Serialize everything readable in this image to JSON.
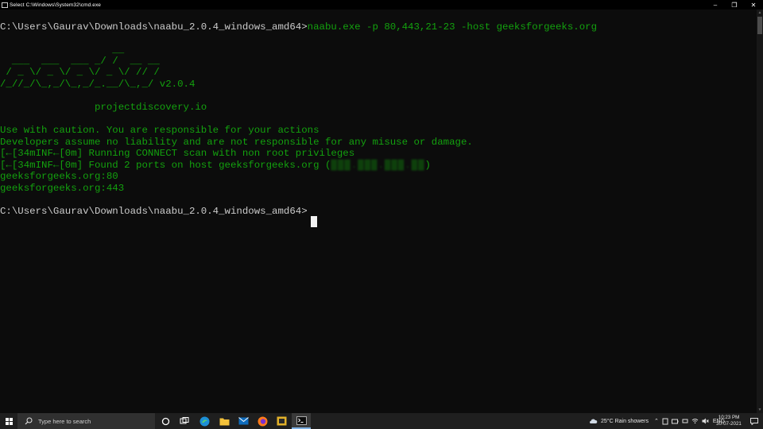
{
  "window": {
    "title": "Select C:\\Windows\\System32\\cmd.exe",
    "minimize_glyph": "–",
    "maximize_glyph": "❐",
    "close_glyph": "✕"
  },
  "console": {
    "line1_prompt": "C:\\Users\\Gaurav\\Downloads\\naabu_2.0.4_windows_amd64>",
    "line1_command": "naabu.exe -p 80,443,21-23 -host geeksforgeeks.org",
    "banner": [
      "                   __",
      "  ___  ___  ___ _/ /  __ __",
      " / _ \\/ _ \\/ _ \\/ _ \\/ // /",
      "/_//_/\\_,_/\\_,_/_.__/\\_,_/ v2.0.4"
    ],
    "site": "                projectdiscovery.io",
    "caution1": "Use with caution. You are responsible for your actions",
    "caution2": "Developers assume no liability and are not responsible for any misuse or damage.",
    "inf1": "[←[34mINF←[0m] Running CONNECT scan with non root privileges",
    "inf2_prefix": "[←[34mINF←[0m] Found 2 ports on host geeksforgeeks.org (",
    "inf2_ip": "███.███.███.██",
    "inf2_suffix": ")",
    "result1": "geeksforgeeks.org:80",
    "result2": "geeksforgeeks.org:443",
    "final_prompt": "C:\\Users\\Gaurav\\Downloads\\naabu_2.0.4_windows_amd64>"
  },
  "taskbar": {
    "search_placeholder": "Type here to search",
    "apps": [
      "task-view",
      "edge",
      "file-explorer",
      "mail",
      "firefox",
      "sandbox",
      "cmd"
    ],
    "weather": "25°C  Rain showers",
    "language": "ENG",
    "time": "10:23 PM",
    "date": "30-07-2021"
  },
  "colors": {
    "console_bg": "#0c0c0c",
    "console_green": "#13a10e",
    "console_gray": "#cccccc",
    "taskbar_bg": "#1f1f1f"
  }
}
